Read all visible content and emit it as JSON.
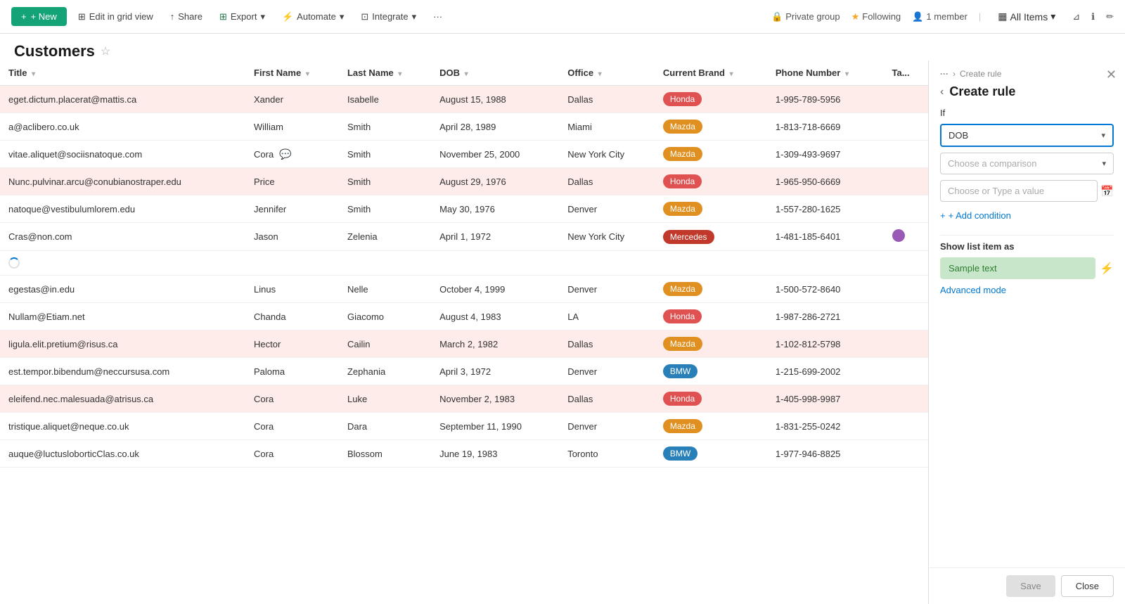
{
  "topbar": {
    "new_label": "+ New",
    "edit_grid_label": "Edit in grid view",
    "share_label": "Share",
    "export_label": "Export",
    "automate_label": "Automate",
    "integrate_label": "Integrate",
    "more_label": "···",
    "all_items_label": "All Items",
    "following_label": "Following",
    "members_label": "1 member",
    "private_group_label": "Private group"
  },
  "page": {
    "title": "Customers"
  },
  "table": {
    "columns": [
      "Title",
      "First Name",
      "Last Name",
      "DOB",
      "Office",
      "Current Brand",
      "Phone Number",
      "Ta..."
    ],
    "rows": [
      {
        "title": "eget.dictum.placerat@mattis.ca",
        "first": "Xander",
        "last": "Isabelle",
        "dob": "August 15, 1988",
        "office": "Dallas",
        "brand": "Honda",
        "brand_class": "badge-honda",
        "phone": "1-995-789-5956",
        "highlight": true,
        "first_class": "text-orange",
        "last_class": "text-red"
      },
      {
        "title": "a@aclibero.co.uk",
        "first": "William",
        "last": "Smith",
        "dob": "April 28, 1989",
        "office": "Miami",
        "brand": "Mazda",
        "brand_class": "badge-mazda",
        "phone": "1-813-718-6669",
        "highlight": false
      },
      {
        "title": "vitae.aliquet@sociisnatoque.com",
        "first": "Cora",
        "last": "Smith",
        "dob": "November 25, 2000",
        "office": "New York City",
        "brand": "Mazda",
        "brand_class": "badge-mazda",
        "phone": "1-309-493-9697",
        "highlight": false,
        "has_chat": true
      },
      {
        "title": "Nunc.pulvinar.arcu@conubianostraper.edu",
        "first": "Price",
        "last": "Smith",
        "dob": "August 29, 1976",
        "office": "Dallas",
        "brand": "Honda",
        "brand_class": "badge-honda",
        "phone": "1-965-950-6669",
        "highlight": true,
        "first_class": "text-orange",
        "last_class": "text-red"
      },
      {
        "title": "natoque@vestibulumlorem.edu",
        "first": "Jennifer",
        "last": "Smith",
        "dob": "May 30, 1976",
        "office": "Denver",
        "brand": "Mazda",
        "brand_class": "badge-mazda",
        "phone": "1-557-280-1625",
        "highlight": false
      },
      {
        "title": "Cras@non.com",
        "first": "Jason",
        "last": "Zelenia",
        "dob": "April 1, 1972",
        "office": "New York City",
        "brand": "Mercedes",
        "brand_class": "badge-mercedes",
        "phone": "1-481-185-6401",
        "highlight": false,
        "color_dot": "purple"
      },
      {
        "title": "",
        "first": "",
        "last": "",
        "dob": "",
        "office": "",
        "brand": "",
        "brand_class": "",
        "phone": "",
        "highlight": false,
        "spinner": true
      },
      {
        "title": "egestas@in.edu",
        "first": "Linus",
        "last": "Nelle",
        "dob": "October 4, 1999",
        "office": "Denver",
        "brand": "Mazda",
        "brand_class": "badge-mazda",
        "phone": "1-500-572-8640",
        "highlight": false
      },
      {
        "title": "Nullam@Etiam.net",
        "first": "Chanda",
        "last": "Giacomo",
        "dob": "August 4, 1983",
        "office": "LA",
        "brand": "Honda",
        "brand_class": "badge-honda",
        "phone": "1-987-286-2721",
        "highlight": false
      },
      {
        "title": "ligula.elit.pretium@risus.ca",
        "first": "Hector",
        "last": "Cailin",
        "dob": "March 2, 1982",
        "office": "Dallas",
        "brand": "Mazda",
        "brand_class": "badge-mazda",
        "phone": "1-102-812-5798",
        "highlight": true,
        "first_class": "text-orange",
        "last_class": "text-red"
      },
      {
        "title": "est.tempor.bibendum@neccursusa.com",
        "first": "Paloma",
        "last": "Zephania",
        "dob": "April 3, 1972",
        "office": "Denver",
        "brand": "BMW",
        "brand_class": "badge-bmw",
        "phone": "1-215-699-2002",
        "highlight": false
      },
      {
        "title": "eleifend.nec.malesuada@atrisus.ca",
        "first": "Cora",
        "last": "Luke",
        "dob": "November 2, 1983",
        "office": "Dallas",
        "brand": "Honda",
        "brand_class": "badge-honda",
        "phone": "1-405-998-9987",
        "highlight": true,
        "first_class": "text-orange",
        "last_class": "text-red"
      },
      {
        "title": "tristique.aliquet@neque.co.uk",
        "first": "Cora",
        "last": "Dara",
        "dob": "September 11, 1990",
        "office": "Denver",
        "brand": "Mazda",
        "brand_class": "badge-mazda",
        "phone": "1-831-255-0242",
        "highlight": false
      },
      {
        "title": "auque@luctusloborticClas.co.uk",
        "first": "Cora",
        "last": "Blossom",
        "dob": "June 19, 1983",
        "office": "Toronto",
        "brand": "BMW",
        "brand_class": "badge-bmw",
        "phone": "1-977-946-8825",
        "highlight": false
      }
    ]
  },
  "panel": {
    "breadcrumb_dots": "···",
    "breadcrumb_crumb": "Create rule",
    "title": "Create rule",
    "if_label": "If",
    "condition_field": "DOB",
    "comparison_placeholder": "Choose a comparison",
    "value_placeholder": "Choose or Type a value",
    "add_condition_label": "+ Add condition",
    "show_as_label": "Show list item as",
    "sample_text": "Sample text",
    "advanced_mode_label": "Advanced mode",
    "save_label": "Save",
    "close_label": "Close"
  }
}
